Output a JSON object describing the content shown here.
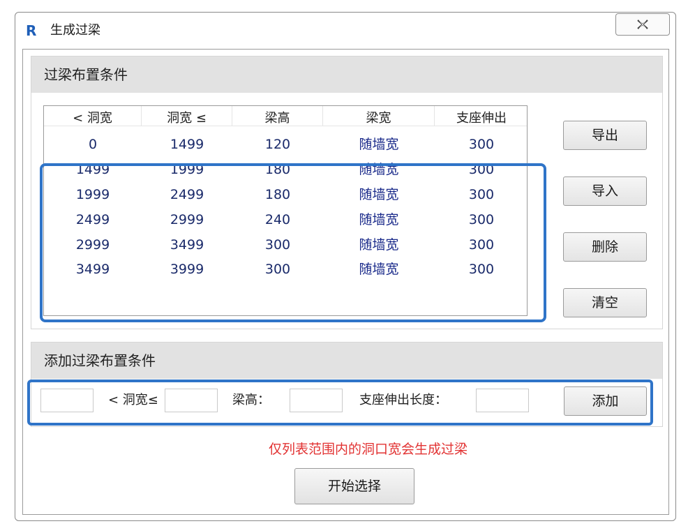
{
  "window": {
    "title": "生成过梁",
    "app_icon_letter": "R",
    "icon": "close-icon"
  },
  "group_conditions": {
    "title": "过梁布置条件",
    "columns": [
      "< 洞宽",
      "洞宽 ≤",
      "梁高",
      "梁宽",
      "支座伸出"
    ],
    "rows": [
      [
        "0",
        "1499",
        "120",
        "随墙宽",
        "300"
      ],
      [
        "1499",
        "1999",
        "180",
        "随墙宽",
        "300"
      ],
      [
        "1999",
        "2499",
        "180",
        "随墙宽",
        "300"
      ],
      [
        "2499",
        "2999",
        "240",
        "随墙宽",
        "300"
      ],
      [
        "2999",
        "3499",
        "300",
        "随墙宽",
        "300"
      ],
      [
        "3499",
        "3999",
        "300",
        "随墙宽",
        "300"
      ]
    ],
    "buttons": {
      "export": "导出",
      "import": "导入",
      "delete": "删除",
      "clear": "清空"
    }
  },
  "group_add": {
    "title": "添加过梁布置条件",
    "label_width": "< 洞宽≤",
    "label_height": "梁高：",
    "label_support": "支座伸出长度：",
    "fields": {
      "min_width": "",
      "max_width": "",
      "beam_height": "",
      "support_length": ""
    },
    "add_button": "添加"
  },
  "note": "仅列表范围内的洞口宽会生成过梁",
  "start_button": "开始选择",
  "colors": {
    "highlight": "#2f74c8",
    "note": "#e23333",
    "group_header": "#e2e2e2",
    "app_icon": "#1f5fb8"
  }
}
